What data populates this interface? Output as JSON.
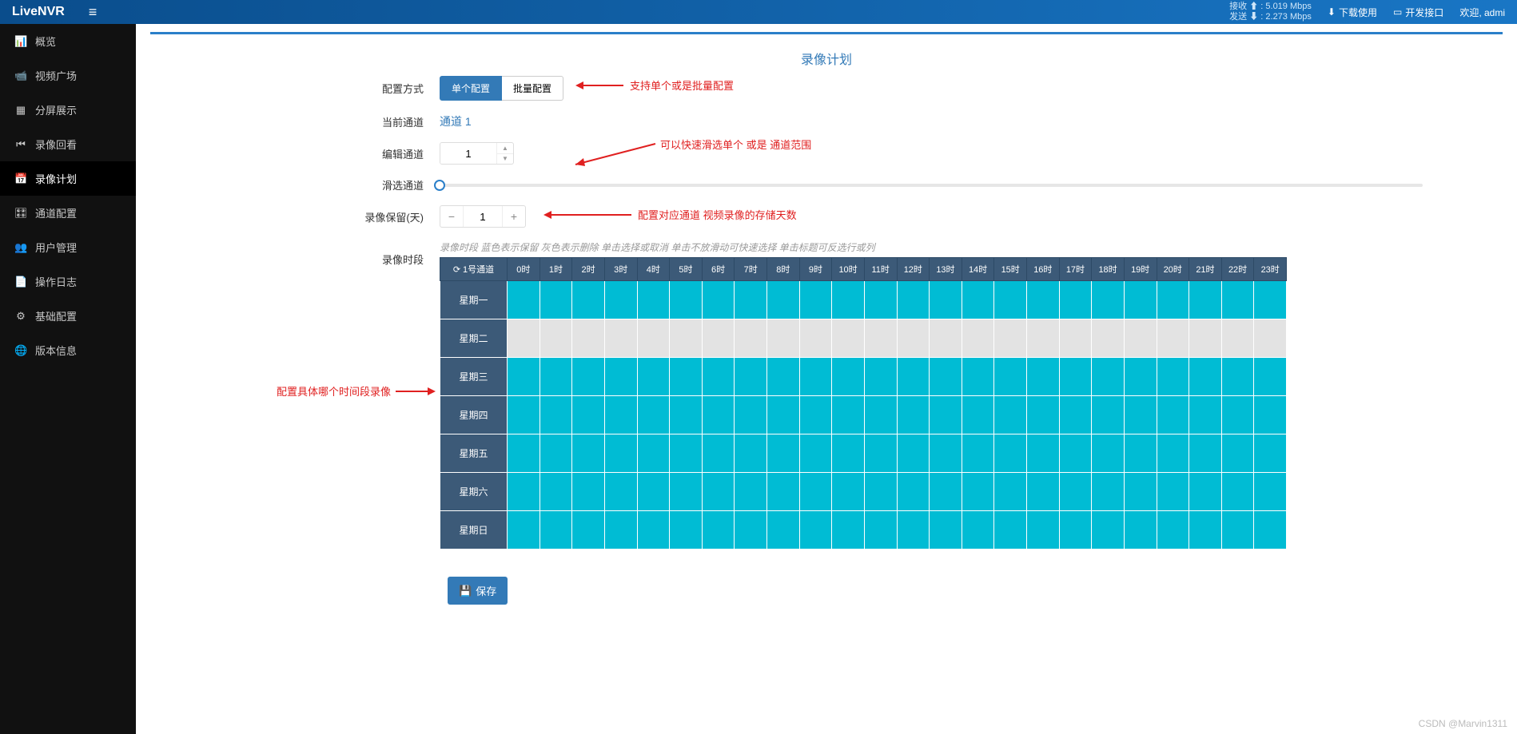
{
  "header": {
    "brand": "LiveNVR",
    "stats_rx_label": "接收",
    "stats_rx": "5.019 Mbps",
    "stats_tx_label": "发送",
    "stats_tx": "2.273 Mbps",
    "download_label": "下载使用",
    "dev_label": "开发接口",
    "welcome_label": "欢迎, admi"
  },
  "sidebar": {
    "items": [
      {
        "label": "概览",
        "icon": "📊"
      },
      {
        "label": "视频广场",
        "icon": "📹"
      },
      {
        "label": "分屏展示",
        "icon": "▦"
      },
      {
        "label": "录像回看",
        "icon": "⏮"
      },
      {
        "label": "录像计划",
        "icon": "📅"
      },
      {
        "label": "通道配置",
        "icon": "🎛"
      },
      {
        "label": "用户管理",
        "icon": "👥"
      },
      {
        "label": "操作日志",
        "icon": "📄"
      },
      {
        "label": "基础配置",
        "icon": "⚙"
      },
      {
        "label": "版本信息",
        "icon": "🌐"
      }
    ],
    "active_index": 4
  },
  "page": {
    "title": "录像计划",
    "labels": {
      "config_mode": "配置方式",
      "current_channel": "当前通道",
      "edit_channel": "编辑通道",
      "slide_channel": "滑选通道",
      "record_keep_days": "录像保留(天)",
      "record_period": "录像时段"
    },
    "config_mode": {
      "single": "单个配置",
      "batch": "批量配置"
    },
    "current_channel_text": "通道 1",
    "edit_channel_value": "1",
    "record_keep_value": "1",
    "hint_text": "录像时段 蓝色表示保留 灰色表示删除 单击选择或取消 单击不放滑动可快速选择 单击标题可反选行或列",
    "save_label": "保存",
    "channel_header": "1号通道",
    "hours": [
      "0时",
      "1时",
      "2时",
      "3时",
      "4时",
      "5时",
      "6时",
      "7时",
      "8时",
      "9时",
      "10时",
      "11时",
      "12时",
      "13时",
      "14时",
      "15时",
      "16时",
      "17时",
      "18时",
      "19时",
      "20时",
      "21时",
      "22时",
      "23时"
    ],
    "days": [
      "星期一",
      "星期二",
      "星期三",
      "星期四",
      "星期五",
      "星期六",
      "星期日"
    ],
    "off_rows": [
      1
    ]
  },
  "annotations": {
    "a1": "支持单个或是批量配置",
    "a2": "可以快速滑选单个 或是 通道范围",
    "a3": "配置对应通道 视频录像的存储天数",
    "a4": "配置具体哪个时间段录像"
  },
  "watermark": "CSDN @Marvin1311"
}
